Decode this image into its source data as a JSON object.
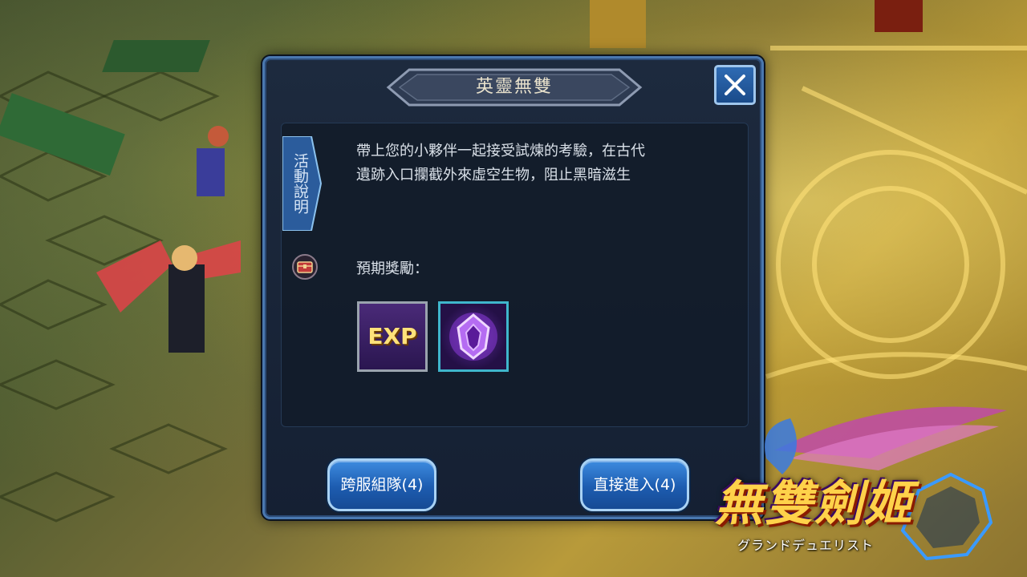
{
  "dialog": {
    "title": "英靈無雙",
    "tab_label": "活動說明",
    "description_line1": "帶上您的小夥伴一起接受試煉的考驗，在古代",
    "description_line2": "遺跡入口攔截外來虛空生物，阻止黑暗滋生",
    "reward_label": "預期獎勵：",
    "rewards": [
      {
        "icon": "exp-icon",
        "text": "EXP"
      },
      {
        "icon": "purple-crystal-icon"
      }
    ],
    "buttons": {
      "cross_server": "跨服組隊(4)",
      "direct_enter": "直接進入(4)"
    }
  },
  "logo": {
    "title": "無雙劍姬",
    "subtitle": "グランドデュエリスト"
  },
  "colors": {
    "panel_bg": "#152033",
    "button_blue": "#1d5cb0",
    "title_text": "#e9e2cc",
    "logo_gold": "#ffd24a"
  }
}
